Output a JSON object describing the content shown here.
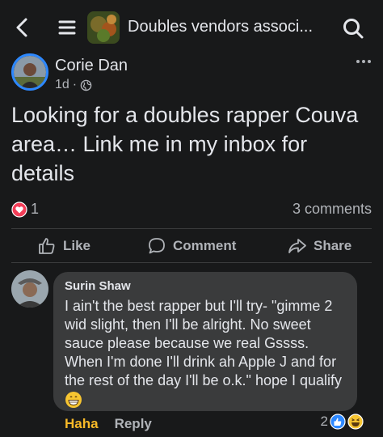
{
  "header": {
    "title": "Doubles vendors associ...",
    "back_icon": "chevron-left-icon",
    "menu_icon": "list-icon",
    "search_icon": "search-icon"
  },
  "post": {
    "author": "Corie Dan",
    "time": "1d",
    "separator": "·",
    "audience_icon": "globe-icon",
    "text": "Looking for a doubles rapper Couva area… Link me in my inbox for details",
    "reaction_count": "1",
    "reaction_type": "love",
    "comments_count": "3 comments"
  },
  "actions": {
    "like": "Like",
    "comment": "Comment",
    "share": "Share"
  },
  "comment": {
    "author": "Surin Shaw",
    "text": "I ain't the best rapper but I'll try- \"gimme 2 wid slight, then I'll be alright. No sweet sauce please because we real Gssss. When I'm done I'll drink ah Apple J and for the rest of the day I'll be o.k.\" hope I qualify",
    "emoji_icon": "grinning-face-icon",
    "haha_label": "Haha",
    "reply_label": "Reply",
    "reaction_count": "2"
  },
  "colors": {
    "background": "#18191a",
    "bubble": "#3a3b3c",
    "text_primary": "#e4e6eb",
    "text_secondary": "#b0b3b8",
    "accent_blue": "#2d88ff",
    "love_red": "#f33e58",
    "haha_yellow": "#f7b928"
  }
}
